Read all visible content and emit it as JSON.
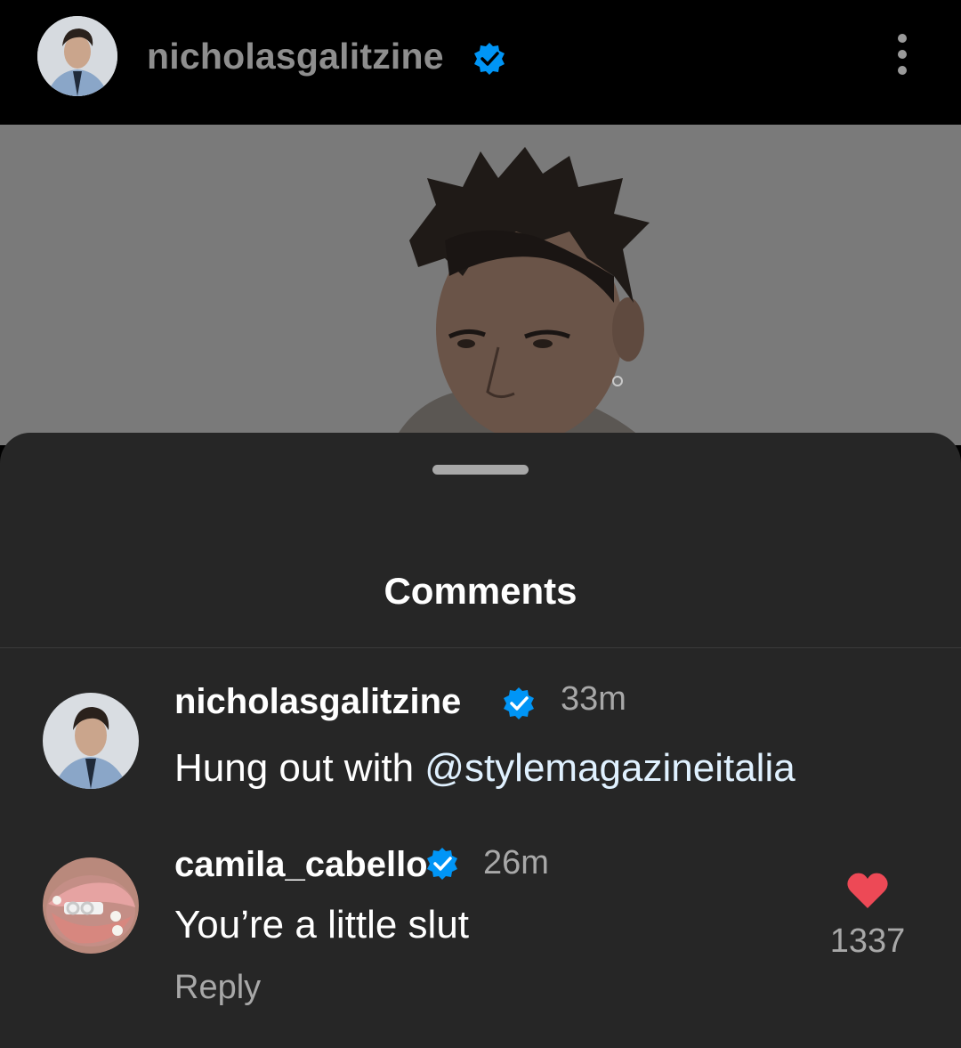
{
  "header": {
    "username": "nicholasgalitzine",
    "verified_color": "#0095f6",
    "menu_icon": "more-vertical-icon"
  },
  "sheet": {
    "title": "Comments"
  },
  "comments": [
    {
      "username": "nicholasgalitzine",
      "time": "33m",
      "text_prefix": "Hung out with ",
      "mention": "@stylemagazineitalia"
    },
    {
      "username": "camila_cabello",
      "time": "26m",
      "text": "You’re a little slut",
      "reply_label": "Reply",
      "like_count": "1337",
      "heart_color": "#ed4956"
    }
  ]
}
